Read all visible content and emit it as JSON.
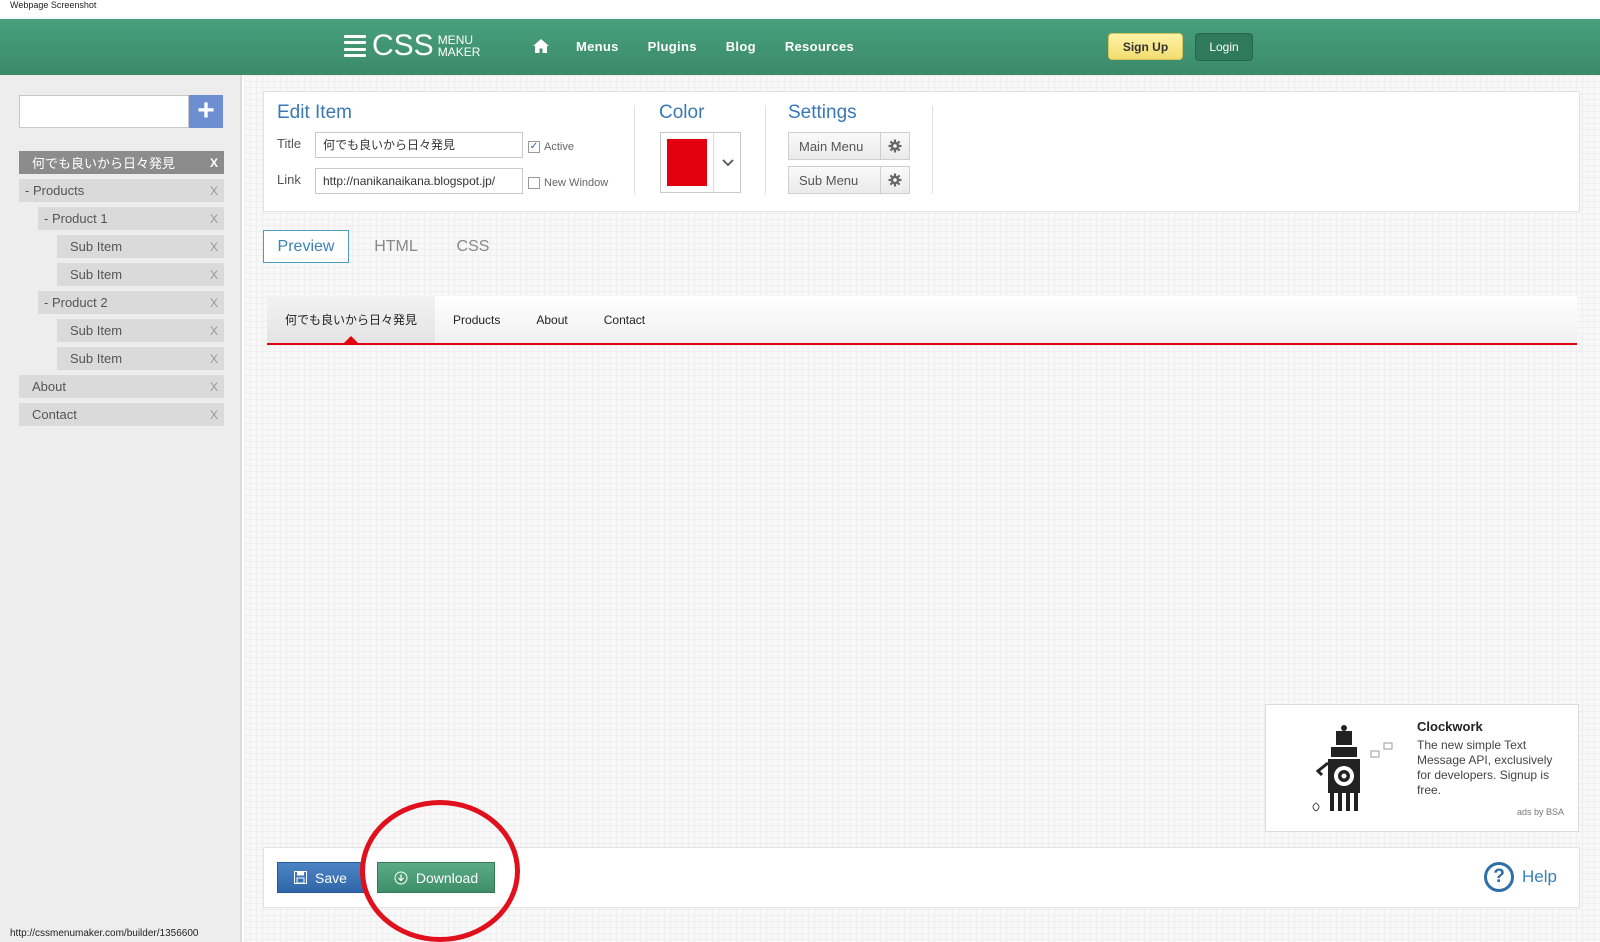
{
  "caption": "Webpage Screenshot",
  "header": {
    "logo_main": "CSS",
    "logo_sub1": "MENU",
    "logo_sub2": "MAKER",
    "nav": [
      "Menus",
      "Plugins",
      "Blog",
      "Resources"
    ],
    "signup_label": "Sign Up",
    "login_label": "Login"
  },
  "sidebar": {
    "add_input_value": "",
    "add_button": "+",
    "items": [
      {
        "label": "何でも良いから日々発見",
        "x": "X"
      },
      {
        "label": "- Products",
        "x": "X"
      },
      {
        "label": "- Product 1",
        "x": "X"
      },
      {
        "label": "Sub Item",
        "x": "X"
      },
      {
        "label": "Sub Item",
        "x": "X"
      },
      {
        "label": "- Product 2",
        "x": "X"
      },
      {
        "label": "Sub Item",
        "x": "X"
      },
      {
        "label": "Sub Item",
        "x": "X"
      },
      {
        "label": "About",
        "x": "X"
      },
      {
        "label": "Contact",
        "x": "X"
      }
    ]
  },
  "edit_item": {
    "heading": "Edit Item",
    "title_label": "Title",
    "title_value": "何でも良いから日々発見",
    "active_label": "Active",
    "active_checked": true,
    "link_label": "Link",
    "link_value": "http://nanikanaikana.blogspot.jp/",
    "new_window_label": "New Window",
    "new_window_checked": false
  },
  "color": {
    "heading": "Color",
    "value": "#e3000f"
  },
  "settings": {
    "heading": "Settings",
    "main_menu_label": "Main Menu",
    "sub_menu_label": "Sub Menu"
  },
  "tabs": [
    "Preview",
    "HTML",
    "CSS"
  ],
  "preview_menu": [
    "何でも良いから日々発見",
    "Products",
    "About",
    "Contact"
  ],
  "ad": {
    "title": "Clockwork",
    "text": "The new simple Text Message API, exclusively for developers. Signup is free.",
    "by": "ads by BSA"
  },
  "footer": {
    "save_label": "Save",
    "download_label": "Download",
    "help_label": "Help"
  },
  "status_url": "http://cssmenumaker.com/builder/1356600"
}
